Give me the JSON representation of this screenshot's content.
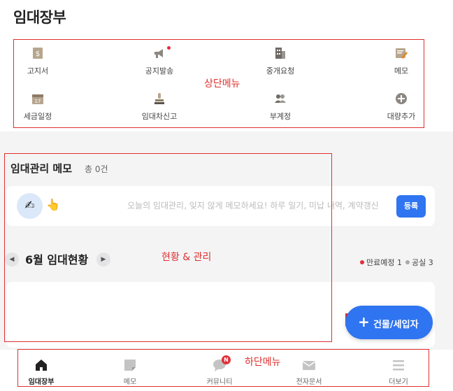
{
  "app_title": "임대장부",
  "top_menu": {
    "annotation": "상단메뉴",
    "items": [
      {
        "label": "고지서",
        "icon": "invoice-icon"
      },
      {
        "label": "공지발송",
        "icon": "megaphone-icon"
      },
      {
        "label": "중개요청",
        "icon": "building-icon"
      },
      {
        "label": "메모",
        "icon": "memo-pen-icon"
      },
      {
        "label": "세금일정",
        "icon": "calendar-icon"
      },
      {
        "label": "임대차신고",
        "icon": "stamp-icon"
      },
      {
        "label": "부계정",
        "icon": "users-icon"
      },
      {
        "label": "대량추가",
        "icon": "plus-circle-icon"
      }
    ]
  },
  "memo": {
    "heading": "임대관리 메모",
    "count": "총 0건",
    "placeholder": "오늘의 임대관리, 잊지 않게 메모하세요! 하루 일기, 미납 내역, 계약갱신",
    "register_button": "등록"
  },
  "status": {
    "annotation": "현황 & 관리",
    "month_title": "6월 임대현황",
    "legend": [
      {
        "label": "만료예정 1",
        "color": "#e0303a"
      },
      {
        "label": "공실 3",
        "color": "#aaaaaa"
      }
    ]
  },
  "fab": {
    "label": "건물/세입자"
  },
  "bottom_nav": {
    "annotation": "하단메뉴",
    "items": [
      {
        "label": "임대장부",
        "icon": "home-icon",
        "active": true
      },
      {
        "label": "메모",
        "icon": "note-icon"
      },
      {
        "label": "커뮤니티",
        "icon": "chat-bubble-icon",
        "badge": "N"
      },
      {
        "label": "전자문서",
        "icon": "envelope-icon"
      },
      {
        "label": "더보기",
        "icon": "menu-icon"
      }
    ]
  },
  "colors": {
    "accent": "#2f74f0",
    "annotation_red": "#e03030"
  }
}
